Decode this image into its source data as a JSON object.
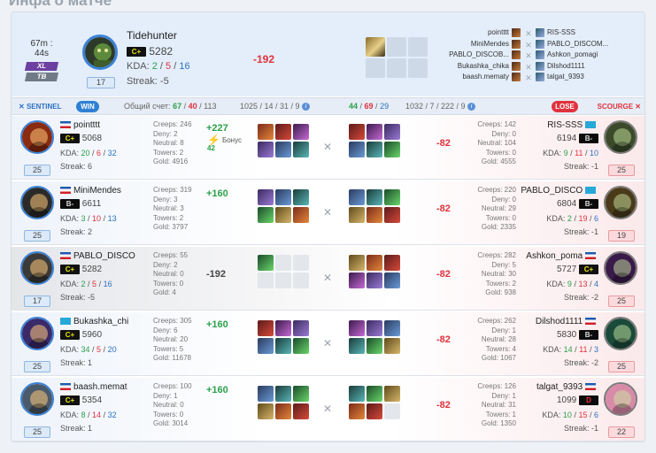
{
  "page": {
    "title": "Инфа о матче"
  },
  "header": {
    "duration": "67m : 44s",
    "mode1": "XL",
    "mode2": "TB",
    "player_name": "Tidehunter",
    "rank": "C+",
    "rating": "5282",
    "kda_label": "KDA:",
    "kda_k": "2",
    "kda_d": "5",
    "kda_a": "16",
    "streak_label": "Streak:",
    "streak": "-5",
    "level": "17",
    "delta": "-192",
    "roster": [
      {
        "left": "pointttt",
        "right": "RIS-SSS"
      },
      {
        "left": "MiniMendes",
        "right": "PABLO_DISCOM..."
      },
      {
        "left": "PABLO_DISCOB...",
        "right": "Ashkon_pomagi"
      },
      {
        "left": "Bukashka_chika",
        "right": "Dilshod1111"
      },
      {
        "left": "baash.mematy",
        "right": "talgat_9393"
      }
    ]
  },
  "summary": {
    "sentinel": "SENTINEL",
    "win": "WIN",
    "score_label": "Общий счет:",
    "s_k": "67",
    "s_d": "40",
    "s_a": "113",
    "s_stats": "1025 / 14 / 31 / 9",
    "c_k": "44",
    "c_d": "69",
    "c_a": "29",
    "c_stats": "1032 / 7 / 222 / 9",
    "lose": "LOSE",
    "scourge": "SCOURGE"
  },
  "colors": {
    "sentinel": "#2c72c4",
    "scourge": "#e0323d",
    "positive": "#2aa14a",
    "rank_badge": "#e7e30f"
  },
  "rows": [
    {
      "l": {
        "name": "pointttt",
        "rank": "C+",
        "rating": "5068",
        "k": "20",
        "d": "6",
        "a": "32",
        "streak": "Streak: 6",
        "level": "25",
        "creeps": "Creeps: 246",
        "deny": "Deny: 2",
        "neutral": "Neutral: 8",
        "towers": "Towers: 2",
        "gold": "Gold: 4916",
        "delta": "+227",
        "bonus_label": "Бонус",
        "bonus": "42"
      },
      "r": {
        "name": "RIS-SSS",
        "rank": "B-",
        "rating": "6194",
        "k": "9",
        "d": "11",
        "a": "10",
        "streak": "Streak: -1",
        "level": "25",
        "creeps": "Creeps: 142",
        "deny": "Deny: 0",
        "neutral": "Neutral: 104",
        "towers": "Towers: 0",
        "gold": "Gold: 4555",
        "delta": "-82"
      }
    },
    {
      "l": {
        "name": "MiniMendes",
        "rank": "B-",
        "rating": "6611",
        "k": "3",
        "d": "10",
        "a": "13",
        "streak": "Streak: 2",
        "level": "25",
        "creeps": "Creeps: 319",
        "deny": "Deny: 3",
        "neutral": "Neutral: 3",
        "towers": "Towers: 2",
        "gold": "Gold: 3797",
        "delta": "+160"
      },
      "r": {
        "name": "PABLO_DISCO",
        "rank": "B-",
        "rating": "6804",
        "k": "2",
        "d": "19",
        "a": "6",
        "streak": "Streak: -1",
        "level": "19",
        "creeps": "Creeps: 220",
        "deny": "Deny: 0",
        "neutral": "Neutral: 29",
        "towers": "Towers: 0",
        "gold": "Gold: 2335",
        "delta": "-82"
      }
    },
    {
      "l": {
        "name": "PABLO_DISCO",
        "rank": "C+",
        "rating": "5282",
        "k": "2",
        "d": "5",
        "a": "16",
        "streak": "Streak: -5",
        "level": "17",
        "creeps": "Creeps: 55",
        "deny": "Deny: 2",
        "neutral": "Neutral: 0",
        "towers": "Towers: 0",
        "gold": "Gold: 4",
        "delta": "-192"
      },
      "r": {
        "name": "Ashkon_poma",
        "rank": "C+",
        "rating": "5727",
        "k": "9",
        "d": "13",
        "a": "4",
        "streak": "Streak: -2",
        "level": "25",
        "creeps": "Creeps: 282",
        "deny": "Deny: 5",
        "neutral": "Neutral: 30",
        "towers": "Towers: 2",
        "gold": "Gold: 938",
        "delta": "-82"
      }
    },
    {
      "l": {
        "name": "Bukashka_chi",
        "rank": "C+",
        "rating": "5960",
        "k": "34",
        "d": "5",
        "a": "20",
        "streak": "Streak: 1",
        "level": "25",
        "creeps": "Creeps: 305",
        "deny": "Deny: 6",
        "neutral": "Neutral: 20",
        "towers": "Towers: 5",
        "gold": "Gold: 11678",
        "delta": "+160"
      },
      "r": {
        "name": "Dilshod1111",
        "rank": "B-",
        "rating": "5830",
        "k": "14",
        "d": "11",
        "a": "3",
        "streak": "Streak: -2",
        "level": "25",
        "creeps": "Creeps: 262",
        "deny": "Deny: 1",
        "neutral": "Neutral: 28",
        "towers": "Towers: 4",
        "gold": "Gold: 1067",
        "delta": "-82"
      }
    },
    {
      "l": {
        "name": "baash.memat",
        "rank": "C+",
        "rating": "5354",
        "k": "8",
        "d": "14",
        "a": "32",
        "streak": "Streak: 1",
        "level": "25",
        "creeps": "Creeps: 100",
        "deny": "Deny: 1",
        "neutral": "Neutral: 0",
        "towers": "Towers: 0",
        "gold": "Gold: 3014",
        "delta": "+160"
      },
      "r": {
        "name": "talgat_9393",
        "rank": "D",
        "rating": "1099",
        "k": "10",
        "d": "15",
        "a": "6",
        "streak": "Streak: -1",
        "level": "22",
        "creeps": "Creeps: 126",
        "deny": "Deny: 1",
        "neutral": "Neutral: 31",
        "towers": "Towers: 1",
        "gold": "Gold: 1350",
        "delta": "-82"
      }
    }
  ]
}
